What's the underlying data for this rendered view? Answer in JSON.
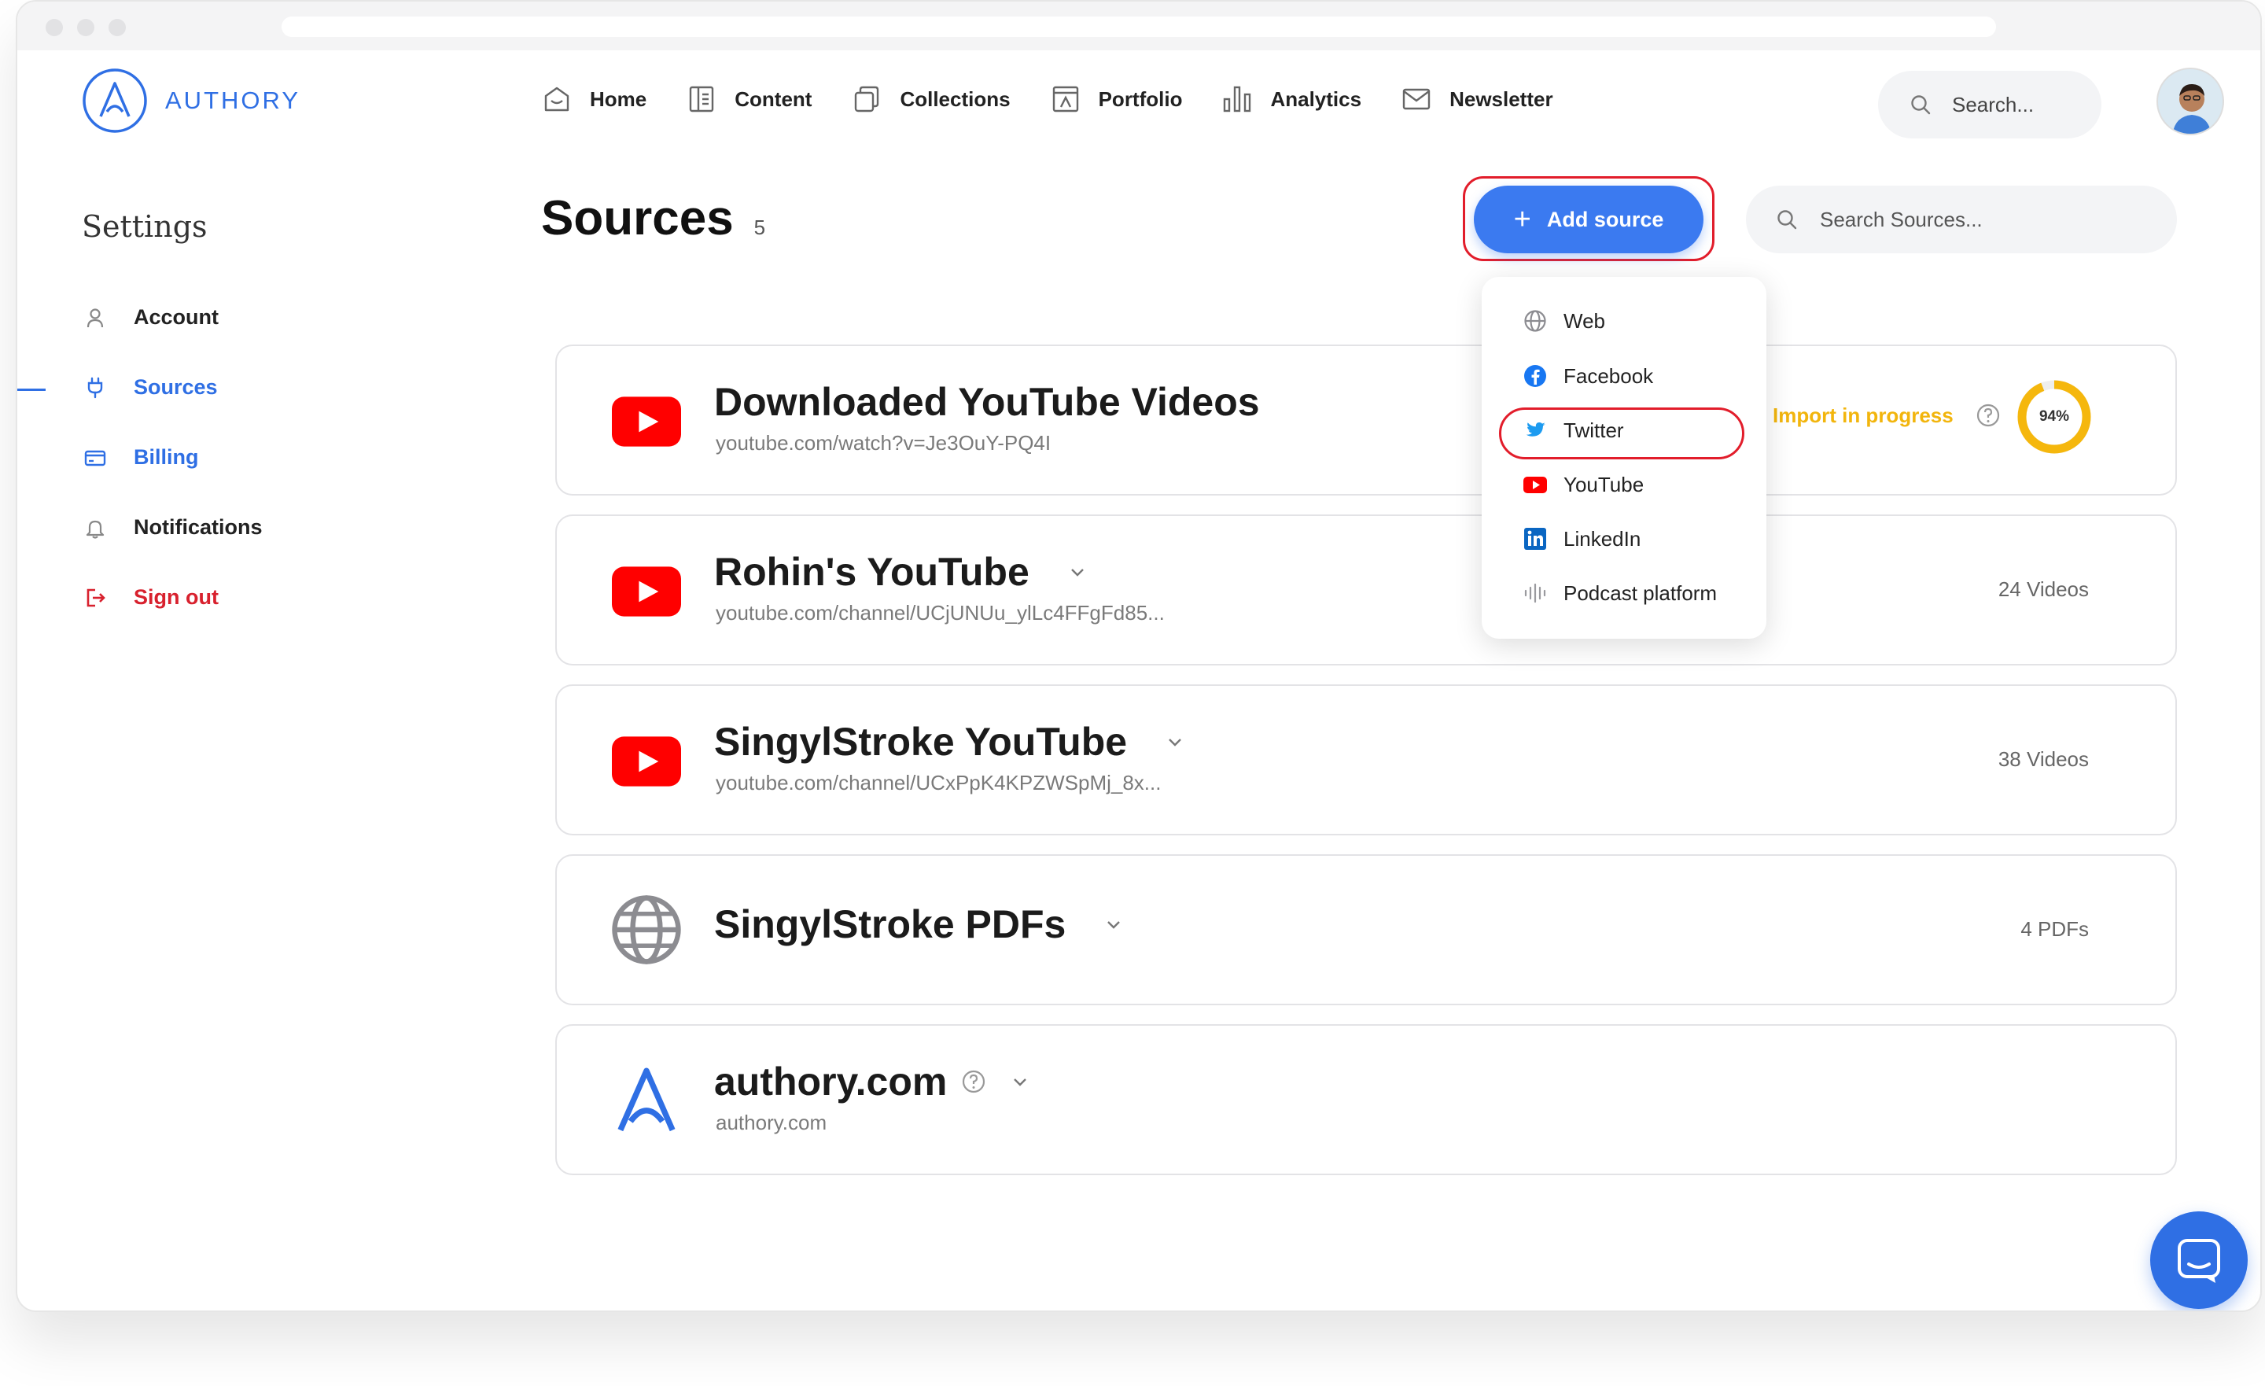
{
  "app": {
    "brand": "AUTHORY",
    "accent_color": "#3b7af0",
    "highlight_color": "#e21d2b"
  },
  "nav": {
    "items": [
      {
        "label": "Home",
        "icon": "home-icon"
      },
      {
        "label": "Content",
        "icon": "content-icon"
      },
      {
        "label": "Collections",
        "icon": "collections-icon"
      },
      {
        "label": "Portfolio",
        "icon": "portfolio-icon"
      },
      {
        "label": "Analytics",
        "icon": "analytics-icon"
      },
      {
        "label": "Newsletter",
        "icon": "newsletter-icon"
      }
    ],
    "search_placeholder": "Search..."
  },
  "sidebar": {
    "title": "Settings",
    "items": [
      {
        "label": "Account",
        "icon": "user-icon",
        "active": false
      },
      {
        "label": "Sources",
        "icon": "plug-icon",
        "active": true
      },
      {
        "label": "Billing",
        "icon": "credit-card-icon",
        "active": false
      },
      {
        "label": "Notifications",
        "icon": "bell-icon",
        "active": false
      },
      {
        "label": "Sign out",
        "icon": "sign-out-icon",
        "active": false
      }
    ]
  },
  "main": {
    "title": "Sources",
    "count": "5",
    "add_button": "Add source",
    "search_placeholder": "Search Sources..."
  },
  "sources": [
    {
      "name": "Downloaded YouTube Videos",
      "url": "youtube.com/watch?v=Je3OuY-PQ4I",
      "icon": "youtube-icon",
      "status": "Import in progress",
      "progress": "94%",
      "progress_value": 0.94
    },
    {
      "name": "Rohin's YouTube",
      "url": "youtube.com/channel/UCjUNUu_ylLc4FFgFd85...",
      "icon": "youtube-icon",
      "meta": "24 Videos"
    },
    {
      "name": "SingylStroke YouTube",
      "url": "youtube.com/channel/UCxPpK4KPZWSpMj_8x...",
      "icon": "youtube-icon",
      "meta": "38 Videos"
    },
    {
      "name": "SingylStroke PDFs",
      "icon": "globe-icon",
      "meta": "4 PDFs"
    },
    {
      "name": "authory.com",
      "url": "authory.com",
      "icon": "authory-logo-icon"
    }
  ],
  "dropdown": {
    "items": [
      {
        "label": "Web",
        "icon": "globe-icon"
      },
      {
        "label": "Facebook",
        "icon": "facebook-icon"
      },
      {
        "label": "Twitter",
        "icon": "twitter-icon",
        "highlighted": true
      },
      {
        "label": "YouTube",
        "icon": "youtube-icon"
      },
      {
        "label": "LinkedIn",
        "icon": "linkedin-icon"
      },
      {
        "label": "Podcast platform",
        "icon": "podcast-icon"
      }
    ]
  }
}
